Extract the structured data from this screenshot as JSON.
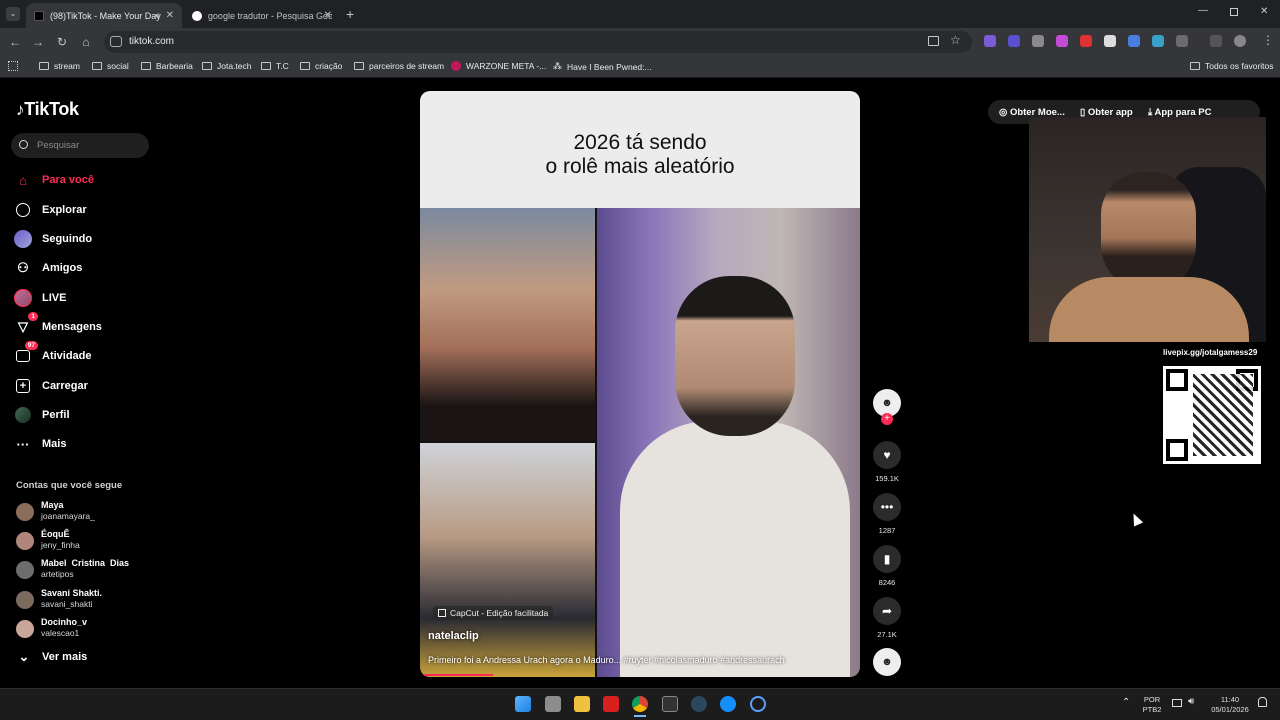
{
  "browser": {
    "tabs": [
      {
        "title": "(98)TikTok - Make Your Day",
        "active": true
      },
      {
        "title": "google tradutor - Pesquisa Goo",
        "active": false
      }
    ],
    "new_tab_icon": "plus-icon",
    "url": "tiktok.com",
    "bookmarks": [
      "stream",
      "social",
      "Barbearia",
      "Jota.tech",
      "T.C",
      "criação",
      "parceiros de stream",
      "WARZONE META -...",
      "Have I Been Pwned:..."
    ],
    "all_bookmarks": "Todos os favoritos"
  },
  "sidebar": {
    "logo": "TikTok",
    "search_placeholder": "Pesquisar",
    "nav": [
      {
        "label": "Para você",
        "icon": "home-icon",
        "active": true
      },
      {
        "label": "Explorar",
        "icon": "compass-icon"
      },
      {
        "label": "Seguindo",
        "icon": "following-avatar-icon"
      },
      {
        "label": "Amigos",
        "icon": "friends-icon"
      },
      {
        "label": "LIVE",
        "icon": "live-avatar-icon"
      },
      {
        "label": "Mensagens",
        "icon": "messages-icon",
        "badge": "1"
      },
      {
        "label": "Atividade",
        "icon": "activity-icon",
        "badge": "97"
      },
      {
        "label": "Carregar",
        "icon": "upload-icon"
      },
      {
        "label": "Perfil",
        "icon": "profile-icon"
      },
      {
        "label": "Mais",
        "icon": "more-icon"
      }
    ],
    "following_title": "Contas que você segue",
    "accounts": [
      {
        "name": "Maya",
        "handle": "joanamayara_"
      },
      {
        "name": "ÉoquÊ",
        "handle": "jeny_finha"
      },
      {
        "name": "Mabel  Cristina  Dias",
        "handle": "artetipos"
      },
      {
        "name": "Savani Shakti.",
        "handle": "savani_shakti"
      },
      {
        "name": "Docinho_v",
        "handle": "valescao1"
      }
    ],
    "see_more": "Ver mais"
  },
  "video": {
    "overlay_title": "2026 tá sendo\no rolê mais aleatório",
    "capcut_label": "CapCut - Edição facilitada",
    "author": "natelaclip",
    "caption": "Primeiro foi a Andressa Urach agora o Maduro... #ruyter #nicolasmaduro #andressaurach",
    "progress": 0.16
  },
  "actions": {
    "likes": "159.1K",
    "comments": "1287",
    "saves": "8246",
    "shares": "27.1K"
  },
  "top_right": {
    "coins": "Obter Moe...",
    "get_app": "Obter app",
    "pc_app": "App para PC"
  },
  "stream_overlay": {
    "qr_label": "livepix.gg/jotalgamess29"
  },
  "taskbar": {
    "lang": "POR",
    "lang2": "PTB2",
    "time": "11:40",
    "date": "05/01/2026"
  },
  "colors": {
    "accent": "#fe2c55",
    "background": "#000000",
    "browser_chrome": "#35363a"
  }
}
